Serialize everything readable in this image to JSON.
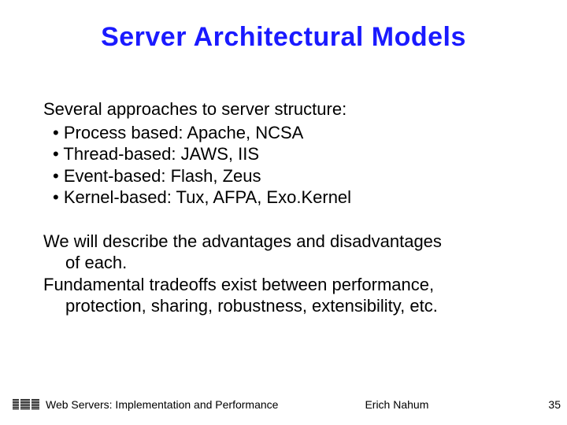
{
  "title": "Server Architectural Models",
  "intro": "Several approaches to server structure:",
  "bullets": {
    "b1": "Process based: Apache, NCSA",
    "b2": "Thread-based: JAWS, IIS",
    "b3": "Event-based: Flash, Zeus",
    "b4": "Kernel-based: Tux, AFPA, Exo.Kernel"
  },
  "para2_line1": "We will describe the advantages and disadvantages",
  "para2_line2": "of each.",
  "para3_line1": "Fundamental tradeoffs exist between performance,",
  "para3_line2": "protection, sharing, robustness, extensibility, etc.",
  "footer": {
    "left": "Web Servers: Implementation and Performance",
    "center": "Erich Nahum",
    "page": "35"
  }
}
